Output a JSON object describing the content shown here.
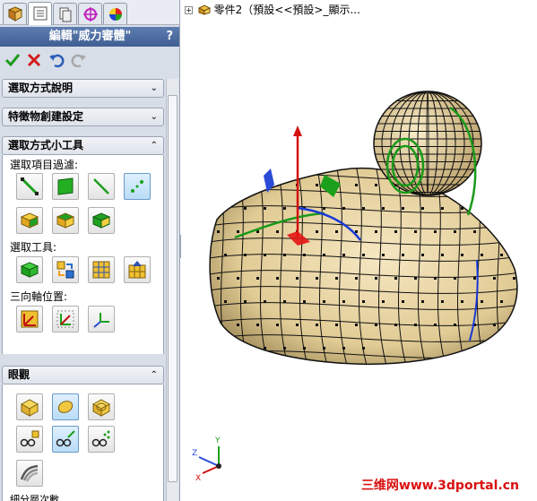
{
  "panel": {
    "tabs": [
      "feature-manager",
      "property-manager",
      "configuration-manager",
      "dimxpert-manager",
      "display-manager"
    ],
    "title": "編輯\"威力審體\"",
    "help": "?",
    "actions": [
      "ok-checkmark",
      "cancel-x",
      "undo",
      "redo"
    ]
  },
  "sections": {
    "selection_help": {
      "label": "選取方式說明",
      "chevron": "⌄⌄"
    },
    "feature_creation": {
      "label": "特徵物創建設定",
      "chevron": "⌄⌄"
    },
    "selection_tools": {
      "label": "選取方式小工具",
      "chevron": "⌃⌃",
      "filter_label": "選取項目過濾:",
      "tool_label": "選取工具:",
      "triad_label": "三向軸位置:"
    },
    "display": {
      "label": "眼觀",
      "chevron": "⌃⌃",
      "last_label": "細分層次數"
    }
  },
  "viewport": {
    "tree_expander": "+",
    "tree_text": "零件2（預設<<預設>_顯示..."
  },
  "triad_axes": {
    "x": "X",
    "y": "Y",
    "z": "Z"
  },
  "watermark": "三维网www.3dportal.cn",
  "colors": {
    "title_bar": "#4a6aa0",
    "panel_bg": "#d8dee8",
    "model": "#e8d6a8",
    "watermark": "#d91010"
  }
}
